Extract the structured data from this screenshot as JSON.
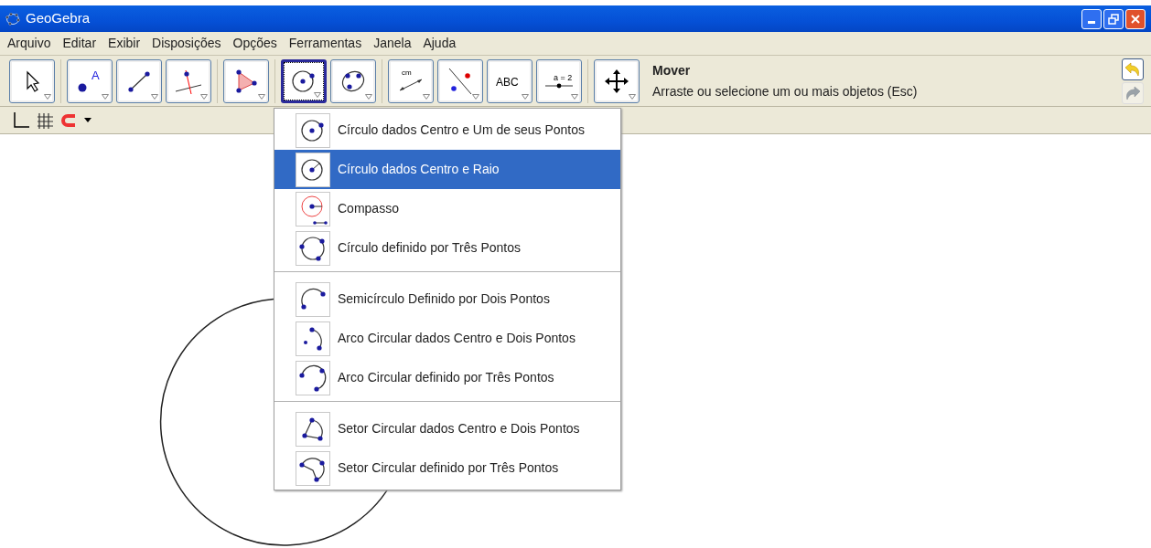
{
  "window": {
    "title": "GeoGebra"
  },
  "menu": [
    "Arquivo",
    "Editar",
    "Exibir",
    "Disposições",
    "Opções",
    "Ferramentas",
    "Janela",
    "Ajuda"
  ],
  "toolbar": {
    "groups": [
      [
        {
          "kind": "move",
          "selected": false
        }
      ],
      [
        {
          "kind": "point",
          "label": "A",
          "selected": false
        },
        {
          "kind": "line",
          "selected": false
        },
        {
          "kind": "perpendicular",
          "selected": false
        }
      ],
      [
        {
          "kind": "polygon",
          "selected": false
        }
      ],
      [
        {
          "kind": "circle",
          "selected": true
        },
        {
          "kind": "conic",
          "selected": false
        }
      ],
      [
        {
          "kind": "distance",
          "label": "cm",
          "selected": false
        },
        {
          "kind": "reflect",
          "selected": false
        },
        {
          "kind": "text",
          "label": "ABC",
          "selected": false
        },
        {
          "kind": "slider",
          "label": "a = 2",
          "selected": false
        }
      ],
      [
        {
          "kind": "pan",
          "selected": false
        }
      ]
    ]
  },
  "tool_help": {
    "title": "Mover",
    "description": "Arraste ou selecione um ou mais objetos (Esc)"
  },
  "history": [
    {
      "kind": "undo",
      "disabled": false
    },
    {
      "kind": "redo",
      "disabled": true
    }
  ],
  "dropdown": {
    "groups": [
      [
        {
          "kind": "center-point",
          "label": "Círculo dados Centro e Um de seus Pontos",
          "selected": false
        },
        {
          "kind": "center-radius",
          "label": "Círculo dados Centro e Raio",
          "selected": true
        },
        {
          "kind": "compass",
          "label": "Compasso",
          "selected": false
        },
        {
          "kind": "three-points",
          "label": "Círculo definido por Três Pontos",
          "selected": false
        }
      ],
      [
        {
          "kind": "semicircle",
          "label": "Semicírculo Definido por Dois Pontos",
          "selected": false
        },
        {
          "kind": "arc-center",
          "label": "Arco Circular dados Centro e Dois Pontos",
          "selected": false
        },
        {
          "kind": "arc-three",
          "label": "Arco Circular definido por Três Pontos",
          "selected": false
        }
      ],
      [
        {
          "kind": "sector-center",
          "label": "Setor Circular dados Centro e Dois Pontos",
          "selected": false
        },
        {
          "kind": "sector-three",
          "label": "Setor Circular definido por Três Pontos",
          "selected": false
        }
      ]
    ]
  }
}
